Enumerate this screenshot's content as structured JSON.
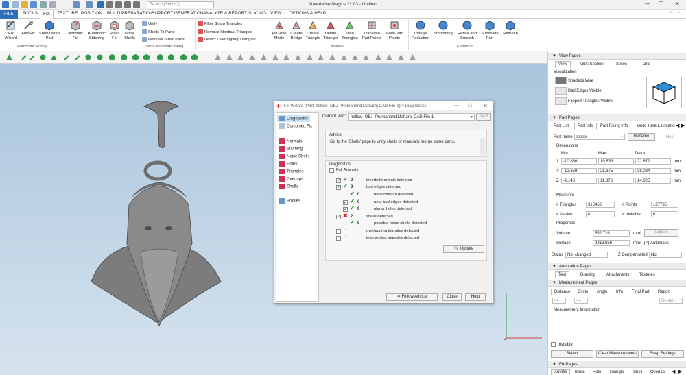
{
  "app": {
    "title": "Materialise Magics 22.03 - Untitled",
    "search_placeholder": "Search (Shift+Q)",
    "window_controls": [
      "minimize-icon",
      "restore-icon",
      "close-icon"
    ]
  },
  "menu": [
    "FILE",
    "TOOLS",
    "FIX",
    "TEXTURE",
    "POSITION",
    "BUILD PREPARATION",
    "SUPPORT GENERATION",
    "ANALYZE & REPORT",
    "SLICING",
    "VIEW",
    "OPTIONS & HELP"
  ],
  "ribbon": {
    "automatic": {
      "group_label": "Automatic Fixing",
      "buttons": [
        {
          "label": "Fix\nWizard",
          "icon": "fix-wizard-icon"
        },
        {
          "label": "AutoFix",
          "icon": "autofix-icon"
        },
        {
          "label": "ShrinkWrap\nPart",
          "icon": "shrinkwrap-icon"
        }
      ]
    },
    "semiauto": {
      "group_label": "Semi-automatic fixing",
      "buttons": [
        {
          "label": "Normals\nFix",
          "icon": "normals-fix-icon"
        },
        {
          "label": "Automatic\nStitching",
          "icon": "stitching-icon"
        },
        {
          "label": "Holes\nFix",
          "icon": "holes-fix-icon"
        },
        {
          "label": "Noise\nShells",
          "icon": "noise-shells-icon"
        }
      ],
      "small": [
        "Unify",
        "Shells To Parts",
        "Remove Small Parts"
      ]
    },
    "triangles_small": [
      "Filter Sharp Triangles",
      "Remove Identical Triangles",
      "Detect Overlapping Triangles"
    ],
    "manual": {
      "group_label": "Manual",
      "buttons": [
        {
          "label": "Fill Hole\nMode"
        },
        {
          "label": "Create\nBridge"
        },
        {
          "label": "Create\nTriangle"
        },
        {
          "label": "Delete\nTriangle"
        },
        {
          "label": "Tree\nTriangles"
        },
        {
          "label": "Translate\nPart Points"
        },
        {
          "label": "Move Part\nPoints"
        }
      ]
    },
    "enhance": {
      "group_label": "Enhance",
      "buttons": [
        {
          "label": "Triangle\nReduction"
        },
        {
          "label": "Smoothing"
        },
        {
          "label": "Refine and\nSmooth"
        },
        {
          "label": "Subdivide\nPart"
        },
        {
          "label": "Remesh"
        }
      ]
    }
  },
  "dialog": {
    "title": "Fix Wizard (Part: hollow- OBJ- Premanand Maharaj CAD File-1) > Diagnostics",
    "nav": [
      "Diagnostics",
      "Combined Fix",
      "Normals",
      "Stitching",
      "Noise Shells",
      "Holes",
      "Triangles",
      "Overlaps",
      "Shells",
      "Profiles"
    ],
    "current_part_label": "Current Part:",
    "current_part_value": "hollow- OBJ- Premanand Maharaj CAD File-1",
    "next_label": "Next",
    "advice_title": "Advice",
    "advice_text": "Go to the 'Shells' page to unify shells or manually merge some parts.",
    "diagnostics_title": "Diagnostics",
    "full_analysis": "Full Analysis",
    "rows": [
      {
        "count": "0",
        "label": "inverted normals detected"
      },
      {
        "count": "0",
        "label": "bad edges detected"
      },
      {
        "count": "0",
        "label": "bad contours detected"
      },
      {
        "count": "0",
        "label": "near bad edges detected"
      },
      {
        "count": "0",
        "label": "planar holes detected"
      },
      {
        "count": "2",
        "label": "shells detected"
      },
      {
        "count": "0",
        "label": "possible noise shells detected"
      },
      {
        "count": "-",
        "label": "overlapping triangles detected"
      },
      {
        "count": "-",
        "label": "intersecting triangles detected"
      }
    ],
    "update_label": "Update",
    "follow_advice_label": "Follow Advice",
    "close_label": "Close",
    "help_label": "Help"
  },
  "view_pages": {
    "header": "View Pages",
    "tabs": [
      "View",
      "Multi-Section",
      "Slices",
      "Grid"
    ],
    "visualization_label": "Visualization",
    "options": [
      "Shaded&Wire",
      "Bad Edges Visible",
      "Flipped Triangles Visible"
    ]
  },
  "part_pages": {
    "header": "Part Pages",
    "tabs": [
      "Part List",
      "Part Info",
      "Part Fixing Info",
      "Build Time Estimation"
    ],
    "part_name_label": "Part name",
    "part_name_value": "sssss",
    "rename_label": "Rename",
    "next_label": "Next",
    "dimensions_label": "Dimensions",
    "dim_headers": [
      "Min",
      "Max",
      "Delta"
    ],
    "dims": [
      {
        "axis": "X",
        "min": "-10.836",
        "max": "10.836",
        "delta": "21.672",
        "unit": "mm"
      },
      {
        "axis": "Y",
        "min": "-12.659",
        "max": "25.375",
        "delta": "38.034",
        "unit": "mm"
      },
      {
        "axis": "Z",
        "min": "-2.146",
        "max": "11.878",
        "delta": "14.025",
        "unit": "mm"
      }
    ],
    "mesh_info_label": "Mesh info",
    "triangles_label": "# Triangles",
    "triangles_value": "315462",
    "points_label": "# Points",
    "points_value": "157735",
    "marked_label": "# Marked",
    "marked_value": "0",
    "invisible_label": "# Invisible",
    "invisible_value": "0",
    "properties_label": "Properties",
    "volume_label": "Volume",
    "volume_value": "552.728",
    "volume_unit": "mm³",
    "update_label": "Update",
    "surface_label": "Surface",
    "surface_value": "2213.656",
    "surface_unit": "mm²",
    "automatic_label": "Automatic",
    "status_label": "Status",
    "status_value": "Not changed",
    "zcomp_label": "Z Compensated",
    "zcomp_value": "No"
  },
  "annotation_pages": {
    "header": "Annotation Pages",
    "tabs": [
      "Text",
      "Drawing",
      "Attachments",
      "Textures"
    ]
  },
  "measurement_pages": {
    "header": "Measurement Pages",
    "tabs": [
      "Distance",
      "Circle",
      "Angle",
      "Info",
      "Final Part",
      "Report"
    ],
    "center_label": "Center",
    "info_label": "Measurement Information",
    "invisible_label": "Invisible",
    "select_label": "Select",
    "clear_label": "Clear Measurements",
    "snap_label": "Snap Settings"
  },
  "fix_pages": {
    "header": "Fix Pages",
    "tabs": [
      "Autofix",
      "Basic",
      "Hole",
      "Triangle",
      "Shell",
      "Overlap"
    ]
  },
  "viewport": {
    "axis_label": "Z"
  },
  "colors": {
    "accent": "#2f6fb7",
    "viewport_top": "#a9c4dc",
    "viewport_bottom": "#d6e3ee",
    "ok_green": "#2f9c2f",
    "error_red": "#d22222"
  }
}
